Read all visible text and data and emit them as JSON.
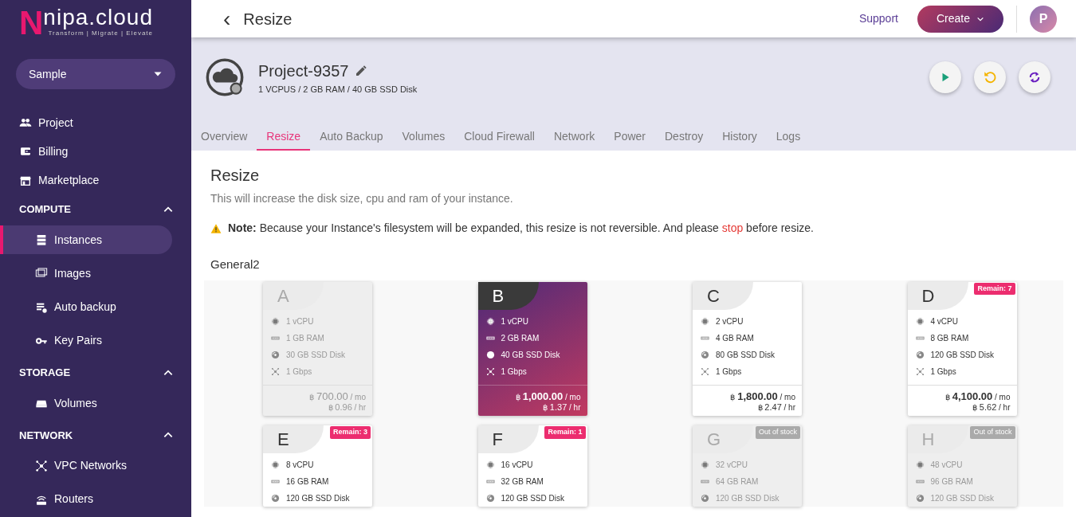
{
  "sidebar": {
    "logo": {
      "mark": "N",
      "name": "nipa.cloud",
      "tagline": "Transform | Migrate | Elevate"
    },
    "project_select": {
      "value": "Sample"
    },
    "items": [
      {
        "kind": "link",
        "label": "Project"
      },
      {
        "kind": "link",
        "label": "Billing"
      },
      {
        "kind": "link",
        "label": "Marketplace"
      },
      {
        "kind": "section",
        "label": "COMPUTE",
        "expanded": true,
        "children": [
          {
            "label": "Instances",
            "selected": true
          },
          {
            "label": "Images",
            "selected": false
          },
          {
            "label": "Auto backup",
            "selected": false
          },
          {
            "label": "Key Pairs",
            "selected": false
          }
        ]
      },
      {
        "kind": "section",
        "label": "STORAGE",
        "expanded": true,
        "children": [
          {
            "label": "Volumes",
            "selected": false
          }
        ]
      },
      {
        "kind": "section",
        "label": "NETWORK",
        "expanded": true,
        "children": [
          {
            "label": "VPC Networks",
            "selected": false
          },
          {
            "label": "Routers",
            "selected": false
          }
        ]
      }
    ]
  },
  "header": {
    "back": "‹",
    "title": "Resize",
    "support": "Support",
    "create": "Create",
    "avatar": "P"
  },
  "instance": {
    "name": "Project-9357",
    "specs": "1 VCPUS / 2 GB RAM / 40 GB SSD Disk"
  },
  "tabs": [
    {
      "label": "Overview",
      "selected": false
    },
    {
      "label": "Resize",
      "selected": true
    },
    {
      "label": "Auto Backup",
      "selected": false
    },
    {
      "label": "Volumes",
      "selected": false
    },
    {
      "label": "Cloud Firewall",
      "selected": false
    },
    {
      "label": "Network",
      "selected": false
    },
    {
      "label": "Power",
      "selected": false
    },
    {
      "label": "Destroy",
      "selected": false
    },
    {
      "label": "History",
      "selected": false
    },
    {
      "label": "Logs",
      "selected": false
    }
  ],
  "content": {
    "title": "Resize",
    "description": "This will increase the disk size, cpu and ram of your instance.",
    "note": {
      "text": "**Note:** Because your Instance's filesystem will be expanded, this resize is not reversible. And please ",
      "link": "stop",
      "text_after": " before resize."
    },
    "group": "General2",
    "plans": [
      {
        "letter": "A",
        "selected": false,
        "disabled": true,
        "specs": [
          "1 vCPU",
          "1 GB RAM",
          "30 GB SSD Disk",
          "1 Gbps"
        ],
        "price": "700.00",
        "per_month": "/ mo",
        "hourly": "0.96",
        "per_hour": "/ hr",
        "currency": "฿"
      },
      {
        "letter": "B",
        "selected": true,
        "disabled": false,
        "specs": [
          "1 vCPU",
          "2 GB RAM",
          "40 GB SSD Disk",
          "1 Gbps"
        ],
        "price": "1,000.00",
        "per_month": "/ mo",
        "hourly": "1.37",
        "per_hour": "/ hr",
        "currency": "฿"
      },
      {
        "letter": "C",
        "selected": false,
        "disabled": false,
        "specs": [
          "2 vCPU",
          "4 GB RAM",
          "80 GB SSD Disk",
          "1 Gbps"
        ],
        "price": "1,800.00",
        "per_month": "/ mo",
        "hourly": "2.47",
        "per_hour": "/ hr",
        "currency": "฿"
      },
      {
        "letter": "D",
        "selected": false,
        "disabled": false,
        "badge": {
          "kind": "remain",
          "text": "Remain: 7"
        },
        "specs": [
          "4 vCPU",
          "8 GB RAM",
          "120 GB SSD Disk",
          "1 Gbps"
        ],
        "price": "4,100.00",
        "per_month": "/ mo",
        "hourly": "5.62",
        "per_hour": "/ hr",
        "currency": "฿"
      },
      {
        "letter": "E",
        "selected": false,
        "disabled": false,
        "badge": {
          "kind": "remain",
          "text": "Remain: 3"
        },
        "specs": [
          "8 vCPU",
          "16 GB RAM",
          "120 GB SSD Disk"
        ]
      },
      {
        "letter": "F",
        "selected": false,
        "disabled": false,
        "badge": {
          "kind": "remain",
          "text": "Remain: 1"
        },
        "specs": [
          "16 vCPU",
          "32 GB RAM",
          "120 GB SSD Disk"
        ]
      },
      {
        "letter": "G",
        "selected": false,
        "disabled": true,
        "badge": {
          "kind": "out_of_stock",
          "text": "Out of stock"
        },
        "specs": [
          "32 vCPU",
          "64 GB RAM",
          "120 GB SSD Disk"
        ]
      },
      {
        "letter": "H",
        "selected": false,
        "disabled": true,
        "badge": {
          "kind": "out_of_stock",
          "text": "Out of stock"
        },
        "specs": [
          "48 vCPU",
          "96 GB RAM",
          "120 GB SSD Disk"
        ]
      }
    ]
  }
}
